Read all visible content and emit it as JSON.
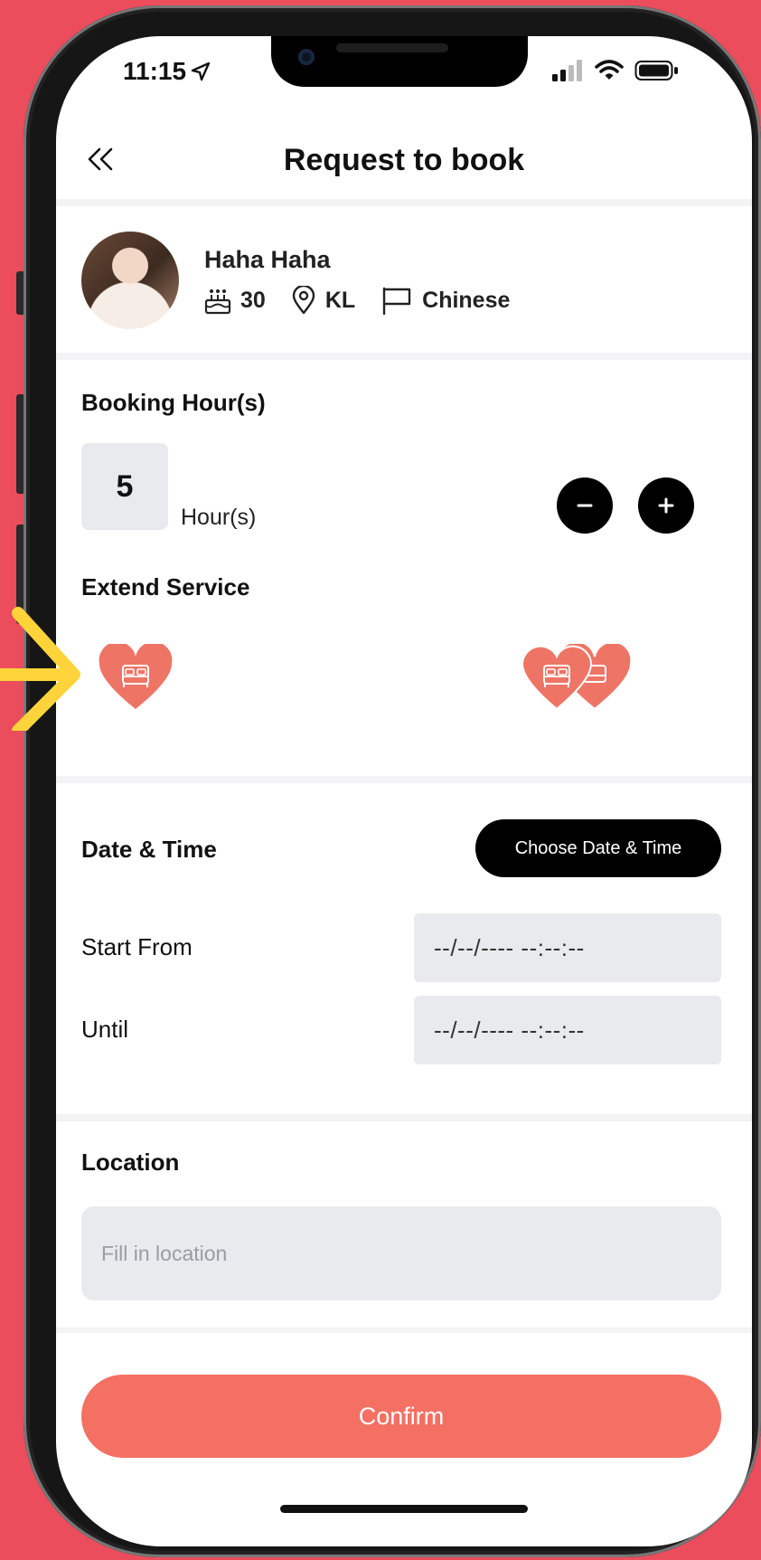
{
  "status_bar": {
    "time": "11:15"
  },
  "header": {
    "title": "Request to book",
    "back_icon": "double-chevron-left-icon"
  },
  "profile": {
    "name": "Haha Haha",
    "age": "30",
    "location": "KL",
    "language": "Chinese",
    "icons": [
      "cake-icon",
      "map-pin-icon",
      "flag-icon"
    ]
  },
  "booking": {
    "title": "Booking Hour(s)",
    "value": "5",
    "unit": "Hour(s)"
  },
  "extend_service": {
    "title": "Extend Service",
    "items": [
      {
        "icon": "heart-bed-icon"
      },
      {
        "icon": "double-heart-bed-icon"
      }
    ]
  },
  "date_time": {
    "title": "Date & Time",
    "choose_label": "Choose Date & Time",
    "start_label": "Start From",
    "start_value": "--/--/---- --:--:--",
    "until_label": "Until",
    "until_value": "--/--/---- --:--:--"
  },
  "location": {
    "title": "Location",
    "placeholder": "Fill in location"
  },
  "confirm_label": "Confirm",
  "colors": {
    "background": "#ec4d5c",
    "accent": "#f47063",
    "annotation": "#ffd43b"
  }
}
